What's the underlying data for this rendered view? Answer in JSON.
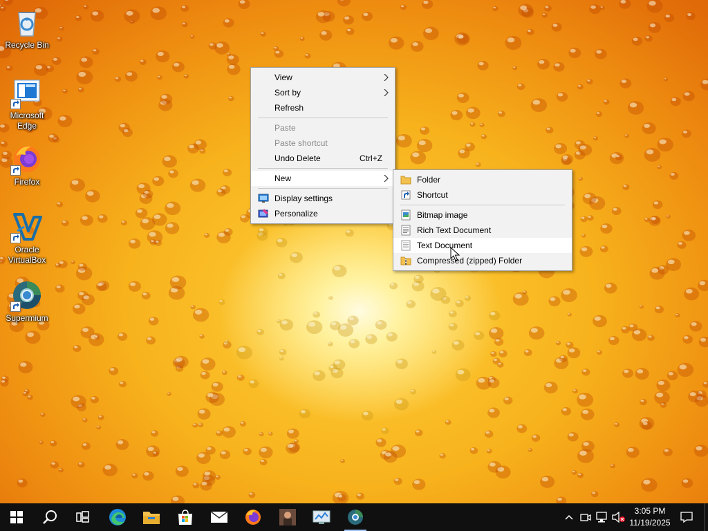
{
  "desktop_icons": [
    {
      "label": "Recycle Bin",
      "icon": "recycle-bin-icon"
    },
    {
      "label": "Microsoft Edge",
      "icon": "microsoft-edge-icon"
    },
    {
      "label": "Firefox",
      "icon": "firefox-icon"
    },
    {
      "label": "Oracle VirtualBox",
      "icon": "virtualbox-icon"
    },
    {
      "label": "Supermium",
      "icon": "supermium-icon"
    }
  ],
  "context_menu": {
    "view": "View",
    "sort_by": "Sort by",
    "refresh": "Refresh",
    "paste": "Paste",
    "paste_shortcut": "Paste shortcut",
    "undo_delete": "Undo Delete",
    "undo_delete_shortcut": "Ctrl+Z",
    "new": "New",
    "display_settings": "Display settings",
    "personalize": "Personalize"
  },
  "new_submenu": {
    "folder": "Folder",
    "shortcut": "Shortcut",
    "bitmap_image": "Bitmap image",
    "rich_text_document": "Rich Text Document",
    "text_document": "Text Document",
    "compressed_folder": "Compressed (zipped) Folder"
  },
  "taskbar": {
    "pinned": [
      "start-icon",
      "search-icon",
      "task-view-icon",
      "edge-icon",
      "file-explorer-icon",
      "microsoft-store-icon",
      "mail-icon",
      "firefox-icon",
      "app-icon",
      "control-panel-icon",
      "supermium-icon"
    ],
    "time": "3:05 PM",
    "date": "11/19/2025"
  },
  "colors": {
    "menu_background": "#f2f2f2",
    "menu_highlight": "#ffffff",
    "disabled_text": "#8a8a8a",
    "taskbar": "#101010",
    "desktop_orange": "#ee8c10",
    "desktop_yellow": "#ffd03a"
  }
}
